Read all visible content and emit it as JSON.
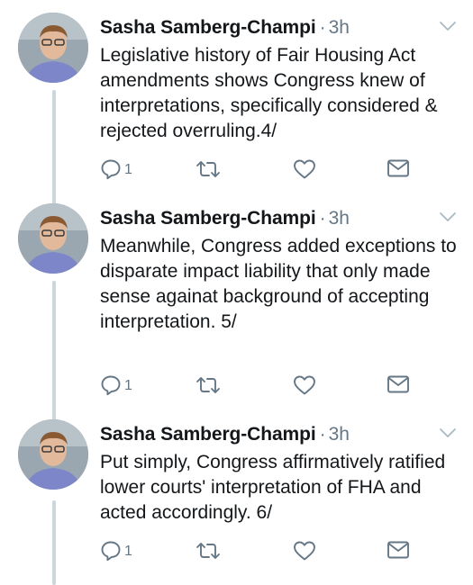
{
  "tweets": [
    {
      "author": "Sasha Samberg-Champi",
      "separator": "·",
      "time": "3h",
      "text": "Legislative history of Fair Housing Act amendments shows Congress knew of interpretations, specifically considered & rejected overruling.4/",
      "reply_count": "1"
    },
    {
      "author": "Sasha Samberg-Champi",
      "separator": "·",
      "time": "3h",
      "text": "Meanwhile, Congress added exceptions to disparate impact liability that only made sense againat background of accepting interpretation. 5/",
      "reply_count": "1"
    },
    {
      "author": "Sasha Samberg-Champi",
      "separator": "·",
      "time": "3h",
      "text": "Put simply, Congress affirmatively ratified lower courts' interpretation of FHA and acted accordingly. 6/",
      "reply_count": "1"
    }
  ],
  "icons": {
    "reply": "reply-icon",
    "retweet": "retweet-icon",
    "like": "heart-icon",
    "dm": "envelope-icon",
    "menu": "chevron-down-icon"
  },
  "colors": {
    "text": "#14171a",
    "secondary": "#657786",
    "thread_line": "#ccd6dd"
  }
}
